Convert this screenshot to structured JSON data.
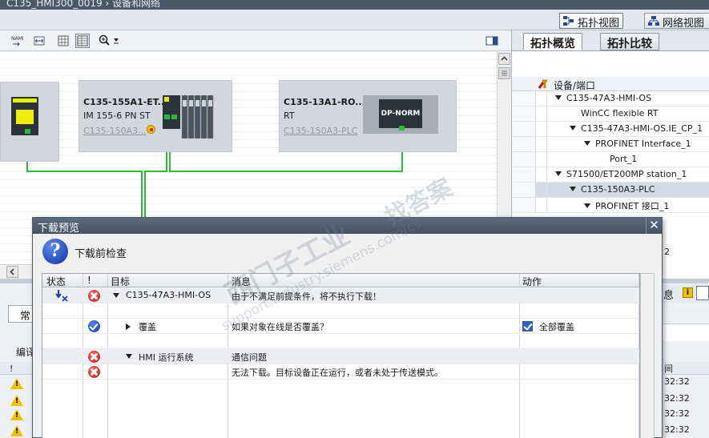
{
  "window": {
    "title": "C135_HMI300_0019  ›  设备和网络"
  },
  "view_tabs": [
    {
      "label": "拓扑视图",
      "active": true
    },
    {
      "label": "网络视图",
      "active": false
    }
  ],
  "canvas": {
    "devices": [
      {
        "title": "C135-155A1-ET...",
        "subtitle": "IM 155-6 PN ST",
        "link": "C135-150A3..."
      },
      {
        "title": "C135-13A1-RO...",
        "subtitle": "RT",
        "link": "C135-150A3-PLC",
        "module_label": "DP-NORM"
      }
    ],
    "cable_color": "#2bb83c"
  },
  "right_panel": {
    "tabs": [
      {
        "label": "拓扑概览",
        "active": true
      },
      {
        "label": "拓扑比较",
        "active": false
      }
    ],
    "column_header": "设备/端口",
    "rows": [
      {
        "label": "C135-47A3-HMI-OS",
        "indent": 0,
        "expand": "open"
      },
      {
        "label": "WinCC flexible RT",
        "indent": 1,
        "expand": "none"
      },
      {
        "label": "C135-47A3-HMI-OS.IE_CP_1",
        "indent": 1,
        "expand": "open"
      },
      {
        "label": "PROFINET Interface_1",
        "indent": 2,
        "expand": "open"
      },
      {
        "label": "Port_1",
        "indent": 3,
        "expand": "none"
      },
      {
        "label": "S71500/ET200MP station_1",
        "indent": 0,
        "expand": "open"
      },
      {
        "label": "C135-150A3-PLC",
        "indent": 1,
        "expand": "open",
        "selected": true
      },
      {
        "label": "PROFINET 接口_1",
        "indent": 2,
        "expand": "open"
      }
    ],
    "partial_text": "2"
  },
  "bottom_panel": {
    "tab_partial": "常",
    "label_partial": "编译",
    "column_partial": "!",
    "info_partial": "息",
    "time_header_partial": "间",
    "times": [
      "32:32",
      "32:32",
      "32:32",
      "32:32"
    ]
  },
  "dialog": {
    "title": "下载预览",
    "subtitle": "下载前检查",
    "columns": {
      "status": "状态",
      "bang": "!",
      "target": "目标",
      "message": "消息",
      "action": "动作"
    },
    "rows": [
      {
        "icon": "error",
        "expand": "open",
        "target": "C135-47A3-HMI-OS",
        "message": "由于不满足前提条件，将不执行下载！",
        "action": "",
        "status_icon": true,
        "level": 0,
        "shade": true
      },
      {
        "icon": "none",
        "expand": "none",
        "target": "",
        "message": "",
        "action": "",
        "level": 0,
        "shade": false
      },
      {
        "icon": "ok",
        "expand": "closed",
        "target": "覆盖",
        "message": "如果对象在线是否覆盖？",
        "action": "全部覆盖",
        "checkbox": true,
        "level": 1,
        "shade": false
      },
      {
        "icon": "none",
        "expand": "none",
        "target": "",
        "message": "",
        "action": "",
        "level": 0,
        "shade": false
      },
      {
        "icon": "error",
        "expand": "open",
        "target": "HMI 运行系统",
        "message": "通信问题",
        "action": "",
        "level": 1,
        "shade": true
      },
      {
        "icon": "error",
        "expand": "none",
        "target": "",
        "message": "无法下载。目标设备正在运行，或者未处于传送模式。",
        "action": "",
        "level": 2,
        "shade": false
      }
    ]
  },
  "watermark": {
    "line1": "西门子工业",
    "line2": "support.industry.siemens.com/cs",
    "line3": "找答案"
  }
}
